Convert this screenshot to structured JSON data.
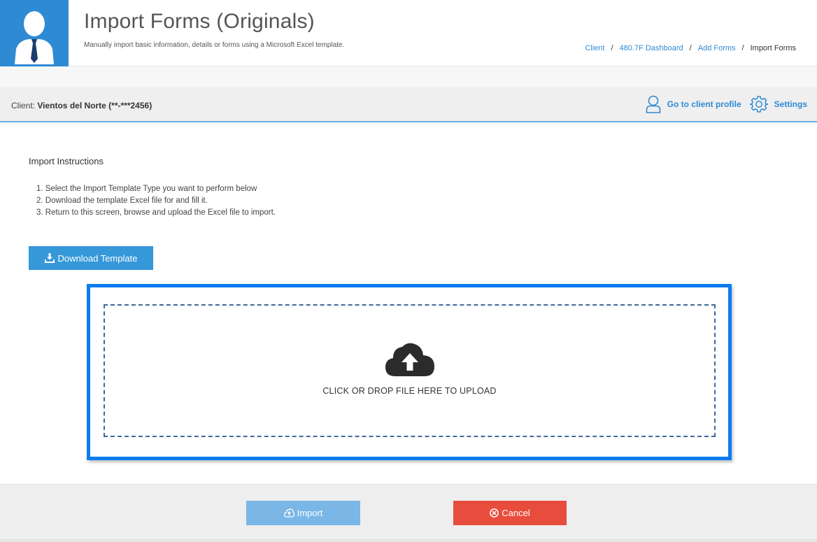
{
  "header": {
    "title": "Import Forms (Originals)",
    "subtitle": "Manually import basic information, details or forms using a Microsoft Excel template.",
    "avatar_icon": "user-avatar-icon",
    "breadcrumb": [
      "Client",
      "480.7F Dashboard",
      "Add Forms",
      "Import Forms"
    ],
    "breadcrumb_separator": "/"
  },
  "client_bar": {
    "label": "Client:",
    "client_name": "Vientos del Norte (**-***2456)",
    "profile_link": "Go to client profile",
    "settings_link": "Settings"
  },
  "instructions": {
    "title": "Import Instructions",
    "steps": [
      "1. Select the Import Template Type you want to perform below",
      "2. Download the template Excel file for and fill it.",
      "3. Return to this screen, browse and upload the Excel file to import."
    ]
  },
  "download_button": "Download Template",
  "dropzone": {
    "text": "CLICK OR DROP FILE HERE TO UPLOAD",
    "icon": "cloud-upload-icon"
  },
  "footer": {
    "import_label": "Import",
    "cancel_label": "Cancel"
  },
  "colors": {
    "accent": "#2f8ad4",
    "highlight_border": "#0c7cf0",
    "import_button": "#7ab6e6",
    "cancel_button": "#e84c3d"
  }
}
